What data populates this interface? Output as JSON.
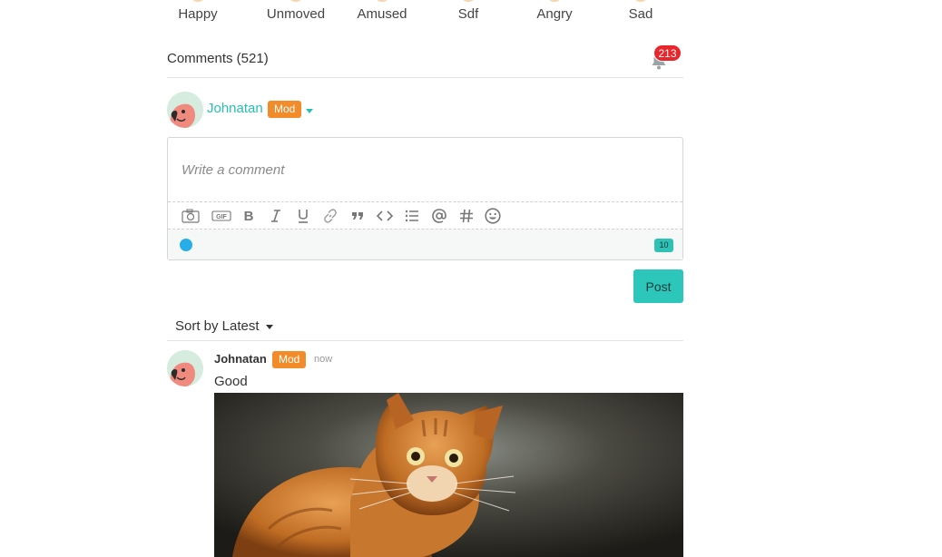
{
  "reactions": [
    {
      "label": "Happy"
    },
    {
      "label": "Unmoved"
    },
    {
      "label": "Amused"
    },
    {
      "label": "Sdf"
    },
    {
      "label": "Angry"
    },
    {
      "label": "Sad"
    }
  ],
  "comments_header": {
    "title": "Comments (521)",
    "notification_count": "213"
  },
  "current_user": {
    "name": "Johnatan",
    "badge": "Mod"
  },
  "editor": {
    "placeholder": "Write a comment",
    "char_count": "10",
    "toolbar": [
      "camera-icon",
      "gif-icon",
      "bold-icon",
      "italic-icon",
      "underline-icon",
      "link-icon",
      "quote-icon",
      "code-icon",
      "list-icon",
      "mention-icon",
      "hashtag-icon",
      "emoji-icon"
    ]
  },
  "post_button_label": "Post",
  "sort_label": "Sort by Latest",
  "comment": {
    "author": "Johnatan",
    "badge": "Mod",
    "time": "now",
    "text": "Good"
  },
  "colors": {
    "accent": "#27bfb3",
    "mod_badge": "#f28c2a",
    "notification_badge": "#e8262c",
    "status_dot": "#27aee8"
  }
}
